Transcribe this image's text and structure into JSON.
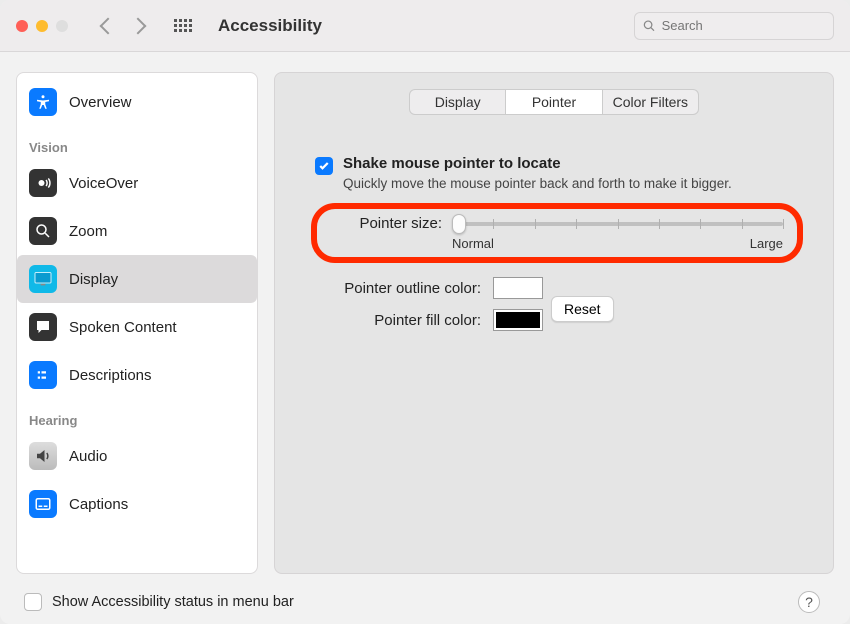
{
  "window": {
    "title": "Accessibility"
  },
  "search": {
    "placeholder": "Search"
  },
  "sidebar": {
    "items": [
      {
        "label": "Overview"
      }
    ],
    "section_vision": "Vision",
    "vision_items": [
      {
        "label": "VoiceOver"
      },
      {
        "label": "Zoom"
      },
      {
        "label": "Display"
      },
      {
        "label": "Spoken Content"
      },
      {
        "label": "Descriptions"
      }
    ],
    "section_hearing": "Hearing",
    "hearing_items": [
      {
        "label": "Audio"
      },
      {
        "label": "Captions"
      }
    ]
  },
  "tabs": {
    "display": "Display",
    "pointer": "Pointer",
    "color_filters": "Color Filters"
  },
  "shake": {
    "label": "Shake mouse pointer to locate",
    "desc": "Quickly move the mouse pointer back and forth to make it bigger.",
    "checked": true
  },
  "pointer_size": {
    "label": "Pointer size:",
    "min_label": "Normal",
    "max_label": "Large",
    "value": 0
  },
  "outline": {
    "label": "Pointer outline color:",
    "color": "#ffffff"
  },
  "fill": {
    "label": "Pointer fill color:",
    "color": "#000000"
  },
  "reset": "Reset",
  "footer": {
    "label": "Show Accessibility status in menu bar",
    "checked": false
  }
}
